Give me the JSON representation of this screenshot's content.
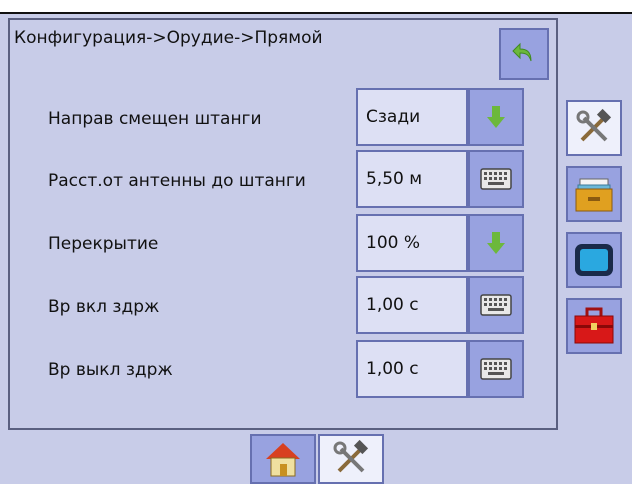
{
  "header": {
    "breadcrumb": "Конфигурация->Орудие->Прямой",
    "back_icon": "back-arrow-icon"
  },
  "rows": [
    {
      "label": "Направ смещен штанги",
      "value": "Сзади",
      "action_icon": "down-arrow-icon"
    },
    {
      "label": "Расст.от антенны до штанги",
      "value": "5,50 м",
      "action_icon": "keyboard-icon"
    },
    {
      "label": "Перекрытие",
      "value": "100  %",
      "action_icon": "down-arrow-icon"
    },
    {
      "label": "Вр вкл здрж",
      "value": "1,00 с",
      "action_icon": "keyboard-icon"
    },
    {
      "label": "Вр выкл здрж",
      "value": "1,00 с",
      "action_icon": "keyboard-icon"
    }
  ],
  "side_tabs": [
    {
      "icon": "tools-icon",
      "active": true
    },
    {
      "icon": "folder-icon",
      "active": false
    },
    {
      "icon": "display-icon",
      "active": false
    },
    {
      "icon": "toolbox-icon",
      "active": false
    }
  ],
  "bottom_tabs": [
    {
      "icon": "home-icon",
      "active": false
    },
    {
      "icon": "tools-icon",
      "active": true
    }
  ],
  "colors": {
    "background": "#c8cce8",
    "button": "#98a2e0",
    "value_box": "#dde0f4",
    "green_arrow": "#6cb83c"
  }
}
